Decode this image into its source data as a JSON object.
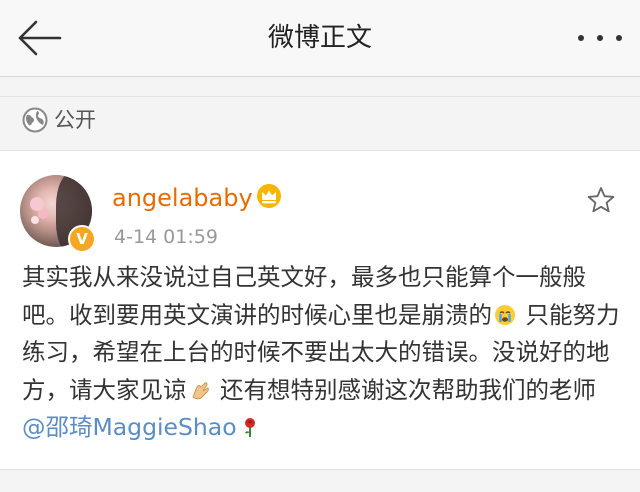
{
  "header": {
    "title": "微博正文",
    "back_icon": "back-arrow-icon",
    "more_icon": "more-dots-icon"
  },
  "visibility": {
    "icon": "globe-icon",
    "label": "公开"
  },
  "post": {
    "username": "angelababy",
    "verified_icon": "verified-v-icon",
    "member_icon": "crown-icon",
    "timestamp": "4-14 01:59",
    "favorite_icon": "star-outline-icon",
    "text_part1": "其实我从来没说过自己英文好，最多也只能算个一般般吧。收到要用英文演讲的时候心里也是崩溃的",
    "text_part2": " 只能努力练习，希望在上台的时候不要出太大的错误。没说好的地方，请大家见谅",
    "text_part3": " 还有想特别感谢这次帮助我们的老师 ",
    "mention": "@邵琦MaggieShao",
    "emojis": [
      "crying-face-emoji",
      "clapping-hands-emoji",
      "rose-emoji"
    ]
  },
  "colors": {
    "username": "#e96a00",
    "mention": "#5b8cc4",
    "badge": "#f5a623"
  }
}
